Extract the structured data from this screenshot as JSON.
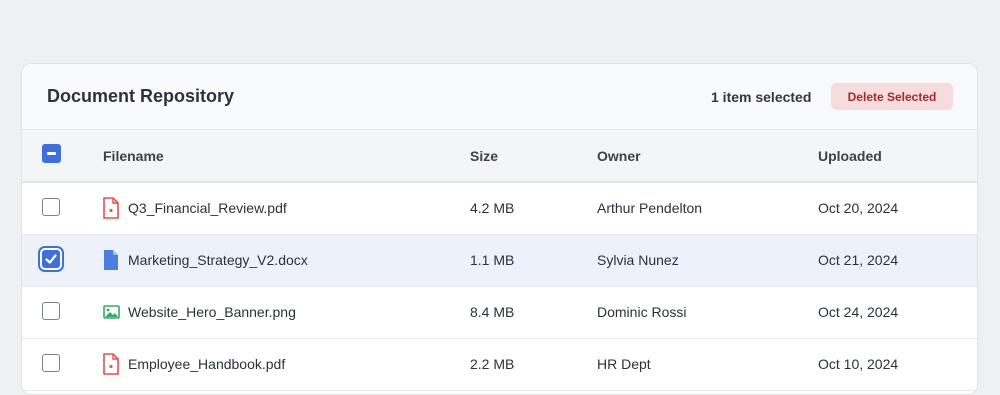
{
  "panel": {
    "title": "Document Repository",
    "selection_count": "1 item selected",
    "delete_label": "Delete Selected"
  },
  "table": {
    "columns": [
      "Filename",
      "Size",
      "Owner",
      "Uploaded"
    ],
    "rows": [
      {
        "filename": "Q3_Financial_Review.pdf",
        "size": "4.2 MB",
        "owner": "Arthur Pendelton",
        "uploaded": "Oct 20, 2024",
        "icon": "pdf-file-icon",
        "selected": false
      },
      {
        "filename": "Marketing_Strategy_V2.docx",
        "size": "1.1 MB",
        "owner": "Sylvia Nunez",
        "uploaded": "Oct 21, 2024",
        "icon": "doc-file-icon",
        "selected": true
      },
      {
        "filename": "Website_Hero_Banner.png",
        "size": "8.4 MB",
        "owner": "Dominic Rossi",
        "uploaded": "Oct 24, 2024",
        "icon": "image-file-icon",
        "selected": false
      },
      {
        "filename": "Employee_Handbook.pdf",
        "size": "2.2 MB",
        "owner": "HR Dept",
        "uploaded": "Oct 10, 2024",
        "icon": "pdf-file-icon",
        "selected": false
      }
    ]
  },
  "colors": {
    "accent": "#3f6fd8",
    "danger_bg": "#f7dcdd",
    "danger_text": "#a42a2c",
    "selected_row": "#edf2fa",
    "pdf_icon": "#e0524f",
    "doc_icon": "#4a7fe0",
    "image_icon": "#3aa66b"
  }
}
